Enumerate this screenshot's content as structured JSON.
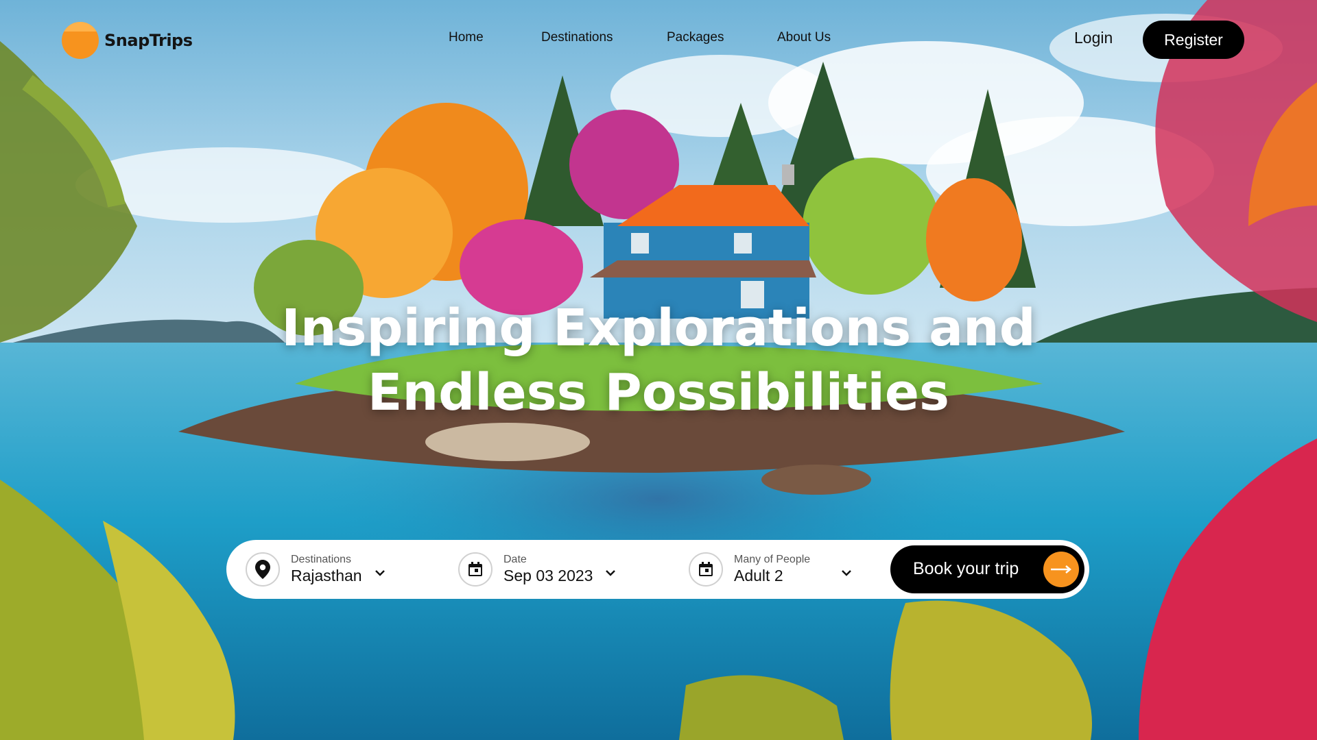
{
  "brand": {
    "name": "SnapTrips"
  },
  "nav": {
    "links": [
      "Home",
      "Destinations",
      "Packages",
      "About Us"
    ],
    "login_label": "Login",
    "register_label": "Register"
  },
  "hero": {
    "line1": "Inspiring Explorations and",
    "line2": "Endless Possibilities"
  },
  "booking": {
    "destination": {
      "label": "Destinations",
      "value": "Rajasthan",
      "icon": "location-pin-icon"
    },
    "date": {
      "label": "Date",
      "value": "Sep 03 2023",
      "icon": "calendar-icon"
    },
    "people": {
      "label": "Many of People",
      "value": "Adult 2",
      "icon": "calendar-icon"
    },
    "book_label": "Book your trip"
  },
  "colors": {
    "accent": "#f7931e",
    "button_dark": "#000000",
    "text": "#111111"
  }
}
